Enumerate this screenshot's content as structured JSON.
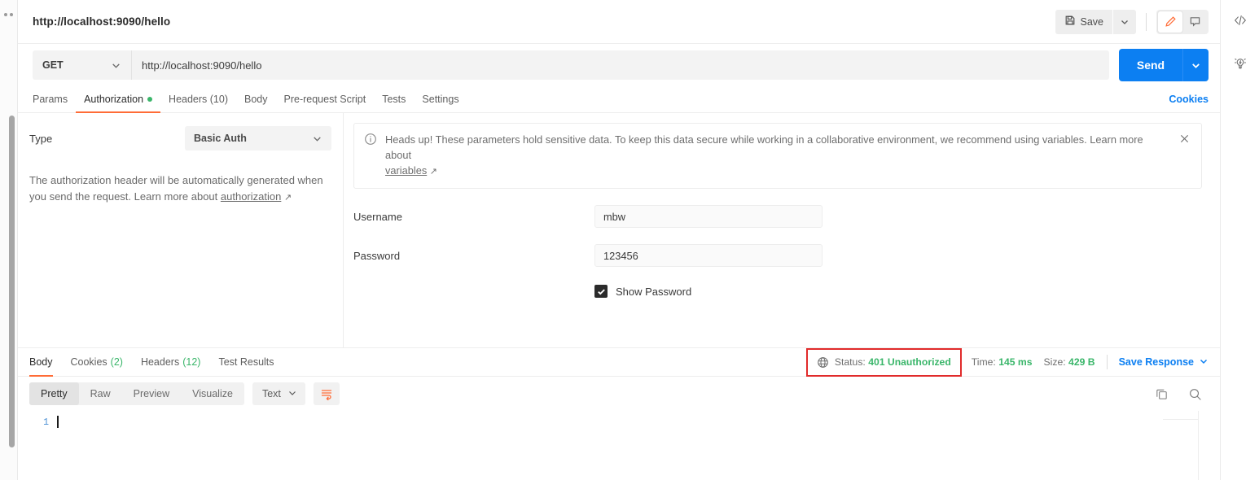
{
  "request": {
    "title": "http://localhost:9090/hello",
    "method": "GET",
    "url": "http://localhost:9090/hello",
    "save_label": "Save",
    "send_label": "Send",
    "cookies_link": "Cookies",
    "tabs": [
      {
        "label": "Params",
        "active": false,
        "dot": false
      },
      {
        "label": "Authorization",
        "active": true,
        "dot": true
      },
      {
        "label": "Headers (10)",
        "active": false,
        "dot": false
      },
      {
        "label": "Body",
        "active": false,
        "dot": false
      },
      {
        "label": "Pre-request Script",
        "active": false,
        "dot": false
      },
      {
        "label": "Tests",
        "active": false,
        "dot": false
      },
      {
        "label": "Settings",
        "active": false,
        "dot": false
      }
    ]
  },
  "auth": {
    "type_label": "Type",
    "type_value": "Basic Auth",
    "description_1": "The authorization header will be automatically generated when you send the request. Learn more about ",
    "description_link": "authorization",
    "notice_text_1": "Heads up! These parameters hold sensitive data. To keep this data secure while working in a collaborative environment, we recommend using ",
    "notice_text_2": "variables. Learn more about",
    "notice_link": "variables",
    "username_label": "Username",
    "username_value": "mbw",
    "password_label": "Password",
    "password_value": "123456",
    "show_password_label": "Show Password"
  },
  "response": {
    "tabs": [
      {
        "label": "Body",
        "count": "",
        "active": true
      },
      {
        "label": "Cookies",
        "count": "(2)",
        "active": false
      },
      {
        "label": "Headers",
        "count": "(12)",
        "active": false
      },
      {
        "label": "Test Results",
        "count": "",
        "active": false
      }
    ],
    "status_label": "Status:",
    "status_value": "401 Unauthorized",
    "time_label": "Time:",
    "time_value": "145 ms",
    "size_label": "Size:",
    "size_value": "429 B",
    "save_response_label": "Save Response",
    "view_modes": [
      {
        "label": "Pretty",
        "active": true
      },
      {
        "label": "Raw",
        "active": false
      },
      {
        "label": "Preview",
        "active": false
      },
      {
        "label": "Visualize",
        "active": false
      }
    ],
    "format_value": "Text",
    "line_number": "1",
    "body_text": ""
  },
  "colors": {
    "accent_orange": "#ff6c37",
    "brand_blue": "#0c7ff2",
    "status_green": "#3ab66a",
    "highlight_red": "#e12b2b"
  },
  "icons": {
    "code": "</>",
    "bulb": "bulb"
  }
}
